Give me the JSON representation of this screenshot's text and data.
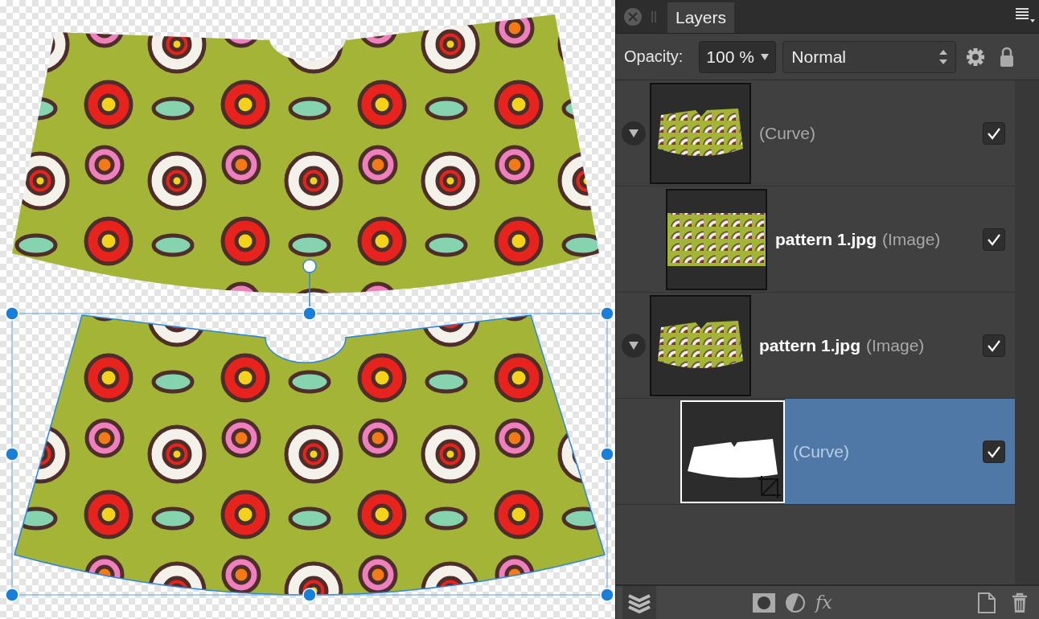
{
  "canvas": {
    "shapes": [
      {
        "kind": "floral",
        "selected": false
      },
      {
        "kind": "floral",
        "selected": true
      }
    ]
  },
  "panel": {
    "tab": {
      "label": "Layers",
      "selected": true
    },
    "opacity_label": "Opacity:",
    "opacity_value": "100 %",
    "blend_mode": "Normal"
  },
  "layers": [
    {
      "type_label": "(Curve)",
      "kind": "shape",
      "expanded": true,
      "visible": true,
      "selected": false,
      "children": [
        {
          "name": "pattern 1.jpg",
          "type_label": "(Image)",
          "kind": "pattern",
          "visible": true,
          "selected": false
        }
      ]
    },
    {
      "name": "pattern 1.jpg",
      "type_label": "(Image)",
      "kind": "shape",
      "expanded": true,
      "visible": true,
      "selected": false,
      "children": [
        {
          "type_label": "(Curve)",
          "kind": "mask",
          "visible": true,
          "selected": true
        }
      ]
    }
  ],
  "bottom_toolbar": {
    "fx_label": "fx"
  }
}
